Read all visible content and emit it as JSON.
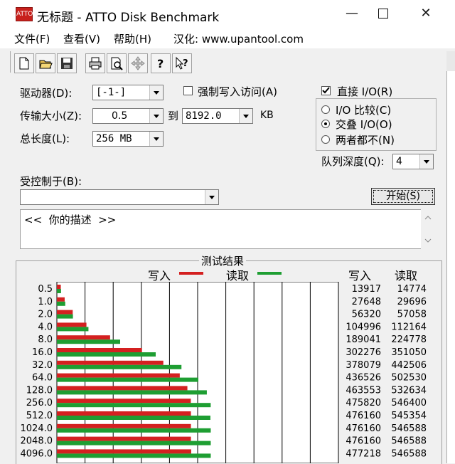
{
  "window": {
    "title": "无标题 - ATTO Disk Benchmark",
    "icon_text": "ATTO",
    "controls": [
      "minimize-icon",
      "maximize-icon",
      "close-icon"
    ]
  },
  "menu": [
    {
      "label": "文件(F)"
    },
    {
      "label": "查看(V)"
    },
    {
      "label": "帮助(H)"
    },
    {
      "label": "汉化: www.upantool.com"
    }
  ],
  "toolbar": [
    "new-file-icon",
    "open-folder-icon",
    "save-icon",
    "print-icon",
    "print-preview-icon",
    "move-icon",
    "help-icon",
    "context-help-icon"
  ],
  "settings": {
    "drive_label": "驱动器(D):",
    "drive_value": "[-1-]",
    "force_write_label": "强制写入访问(A)",
    "force_write_checked": false,
    "transfer_label": "传输大小(Z):",
    "transfer_from": "0.5",
    "to_label": "到",
    "transfer_to": "8192.0",
    "unit": "KB",
    "length_label": "总长度(L):",
    "length_value": "256 MB",
    "direct_io_label": "直接 I/O(R)",
    "direct_io_checked": true,
    "io_options": [
      "I/O 比较(C)",
      "交叠 I/O(O)",
      "两者都不(N)"
    ],
    "io_selected": 1,
    "queue_label": "队列深度(Q):",
    "queue_value": "4",
    "controlled_label": "受控制于(B):",
    "controlled_value": "",
    "start_button": "开始(S)",
    "description": "<<  你的描述  >>"
  },
  "results": {
    "title": "测试结果",
    "write_label": "写入",
    "read_label": "读取",
    "write_col": "写入",
    "read_col": "读取",
    "colors": {
      "write": "#d42020",
      "read": "#1e9e32"
    }
  },
  "chart_data": {
    "type": "bar",
    "orientation": "horizontal",
    "categories": [
      "0.5",
      "1.0",
      "2.0",
      "4.0",
      "8.0",
      "16.0",
      "32.0",
      "64.0",
      "128.0",
      "256.0",
      "512.0",
      "1024.0",
      "2048.0",
      "4096.0"
    ],
    "series": [
      {
        "name": "写入",
        "values": [
          13917,
          27648,
          56320,
          104996,
          189041,
          302276,
          378079,
          436526,
          463553,
          475820,
          476160,
          476160,
          476160,
          477218
        ]
      },
      {
        "name": "读取",
        "values": [
          14774,
          29696,
          57058,
          112164,
          224778,
          351050,
          442506,
          502530,
          532634,
          546400,
          545354,
          546588,
          546588,
          546588
        ]
      }
    ],
    "xlim": [
      0,
      1000000
    ],
    "grid": true
  }
}
